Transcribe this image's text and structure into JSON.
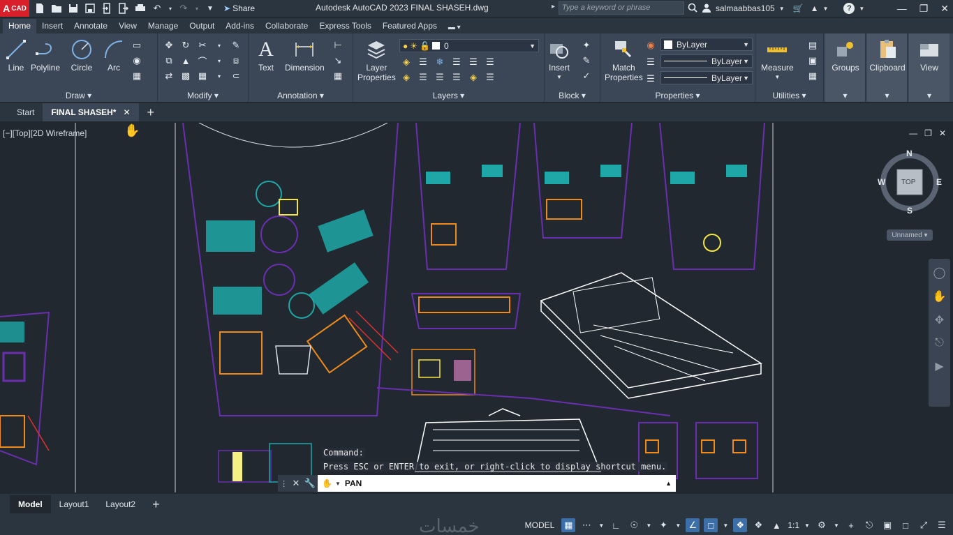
{
  "app": {
    "logo_big": "A",
    "logo_small": "CAD",
    "share_label": "Share",
    "title": "Autodesk AutoCAD 2023    FINAL SHASEH.dwg",
    "search_placeholder": "Type a keyword or phrase",
    "user": "salmaabbas105"
  },
  "ribbon_tabs": [
    "Home",
    "Insert",
    "Annotate",
    "View",
    "Manage",
    "Output",
    "Add-ins",
    "Collaborate",
    "Express Tools",
    "Featured Apps"
  ],
  "ribbon": {
    "draw": {
      "title": "Draw",
      "tools": [
        "Line",
        "Polyline",
        "Circle",
        "Arc"
      ]
    },
    "modify": {
      "title": "Modify"
    },
    "annotation": {
      "title": "Annotation",
      "text": "Text",
      "dimension": "Dimension"
    },
    "layers": {
      "title": "Layers",
      "layer_props_1": "Layer",
      "layer_props_2": "Properties",
      "current_layer": "0"
    },
    "block": {
      "title": "Block",
      "insert": "Insert"
    },
    "properties": {
      "title": "Properties",
      "match_1": "Match",
      "match_2": "Properties",
      "color": "ByLayer",
      "linetype": "ByLayer",
      "lineweight": "ByLayer"
    },
    "utilities": {
      "title": "Utilities",
      "measure": "Measure"
    },
    "groups": "Groups",
    "clipboard": "Clipboard",
    "view": "View"
  },
  "file_tabs": {
    "start": "Start",
    "active": "FINAL SHASEH*"
  },
  "canvas": {
    "view_label": "[−][Top][2D Wireframe]",
    "viewcube": {
      "n": "N",
      "s": "S",
      "e": "E",
      "w": "W",
      "face": "TOP"
    },
    "ucs": "Unnamed",
    "cmd_history_1": "Command:",
    "cmd_history_2": "Press ESC or ENTER to exit, or right-click to display shortcut menu.",
    "cmd_input": "PAN"
  },
  "layout_tabs": [
    "Model",
    "Layout1",
    "Layout2"
  ],
  "status": {
    "watermark": "خمسات",
    "model": "MODEL",
    "scale": "1:1"
  }
}
